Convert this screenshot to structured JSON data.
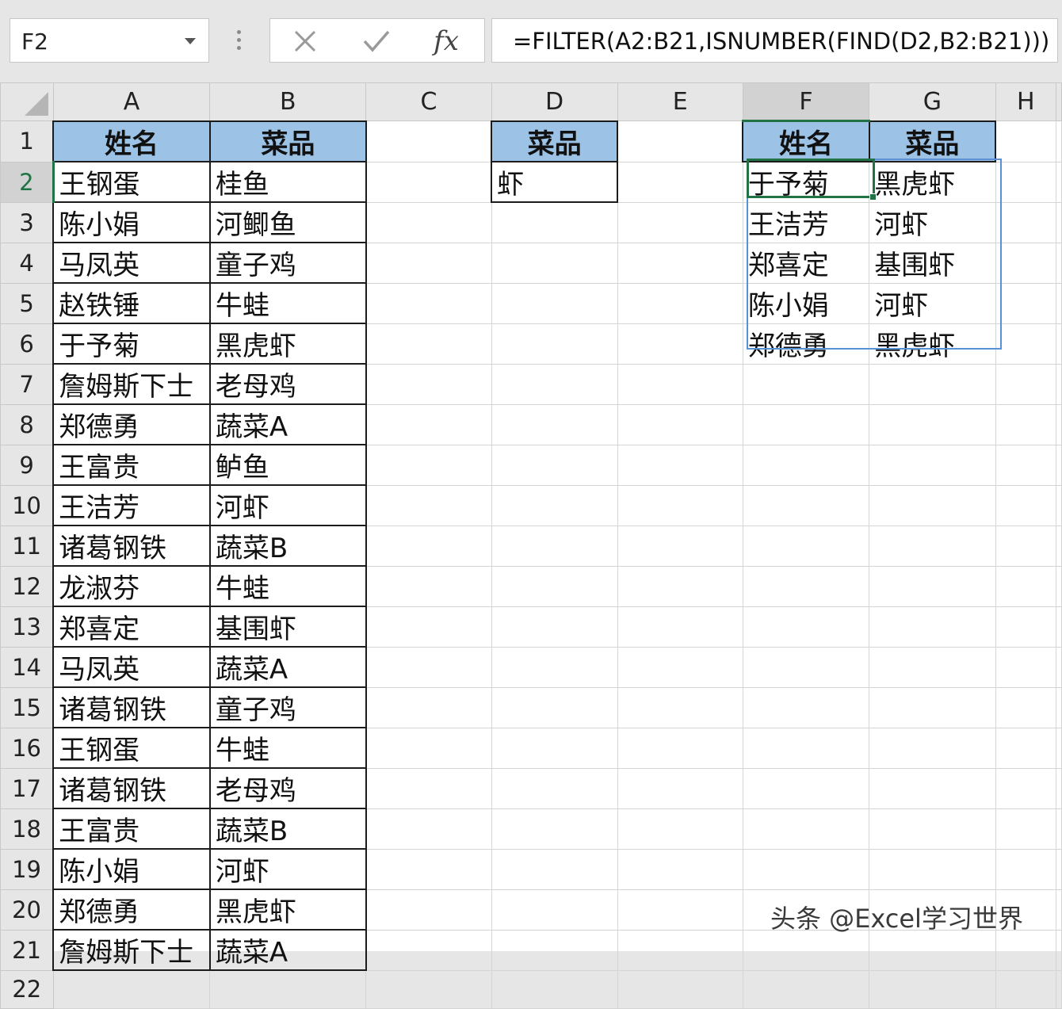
{
  "name_box": {
    "value": "F2"
  },
  "formula_bar": {
    "cancel_icon": "x-icon",
    "enter_icon": "check-icon",
    "fx_label": "fx",
    "formula": "=FILTER(A2:B21,ISNUMBER(FIND(D2,B2:B21)))"
  },
  "columns": [
    "A",
    "B",
    "C",
    "D",
    "E",
    "F",
    "G",
    "H"
  ],
  "rows": [
    "1",
    "2",
    "3",
    "4",
    "5",
    "6",
    "7",
    "8",
    "9",
    "10",
    "11",
    "12",
    "13",
    "14",
    "15",
    "16",
    "17",
    "18",
    "19",
    "20",
    "21",
    "22"
  ],
  "source_table": {
    "header": [
      "姓名",
      "菜品"
    ],
    "rows": [
      [
        "王钢蛋",
        "桂鱼"
      ],
      [
        "陈小娟",
        "河鲫鱼"
      ],
      [
        "马凤英",
        "童子鸡"
      ],
      [
        "赵铁锤",
        "牛蛙"
      ],
      [
        "于予菊",
        "黑虎虾"
      ],
      [
        "詹姆斯下士",
        "老母鸡"
      ],
      [
        "郑德勇",
        "蔬菜A"
      ],
      [
        "王富贵",
        "鲈鱼"
      ],
      [
        "王洁芳",
        "河虾"
      ],
      [
        "诸葛钢铁",
        "蔬菜B"
      ],
      [
        "龙淑芬",
        "牛蛙"
      ],
      [
        "郑喜定",
        "基围虾"
      ],
      [
        "马凤英",
        "蔬菜A"
      ],
      [
        "诸葛钢铁",
        "童子鸡"
      ],
      [
        "王钢蛋",
        "牛蛙"
      ],
      [
        "诸葛钢铁",
        "老母鸡"
      ],
      [
        "王富贵",
        "蔬菜B"
      ],
      [
        "陈小娟",
        "河虾"
      ],
      [
        "郑德勇",
        "黑虎虾"
      ],
      [
        "詹姆斯下士",
        "蔬菜A"
      ]
    ]
  },
  "criteria": {
    "header": "菜品",
    "value": "虾"
  },
  "result_table": {
    "header": [
      "姓名",
      "菜品"
    ],
    "rows": [
      [
        "于予菊",
        "黑虎虾"
      ],
      [
        "王洁芳",
        "河虾"
      ],
      [
        "郑喜定",
        "基围虾"
      ],
      [
        "陈小娟",
        "河虾"
      ],
      [
        "郑德勇",
        "黑虎虾"
      ]
    ]
  },
  "selected_cell": "F2",
  "watermark": "头条 @Excel学习世界",
  "colors": {
    "header_fill": "#9cc3e5",
    "selection": "#217346",
    "spill_border": "#5b8fd6"
  }
}
